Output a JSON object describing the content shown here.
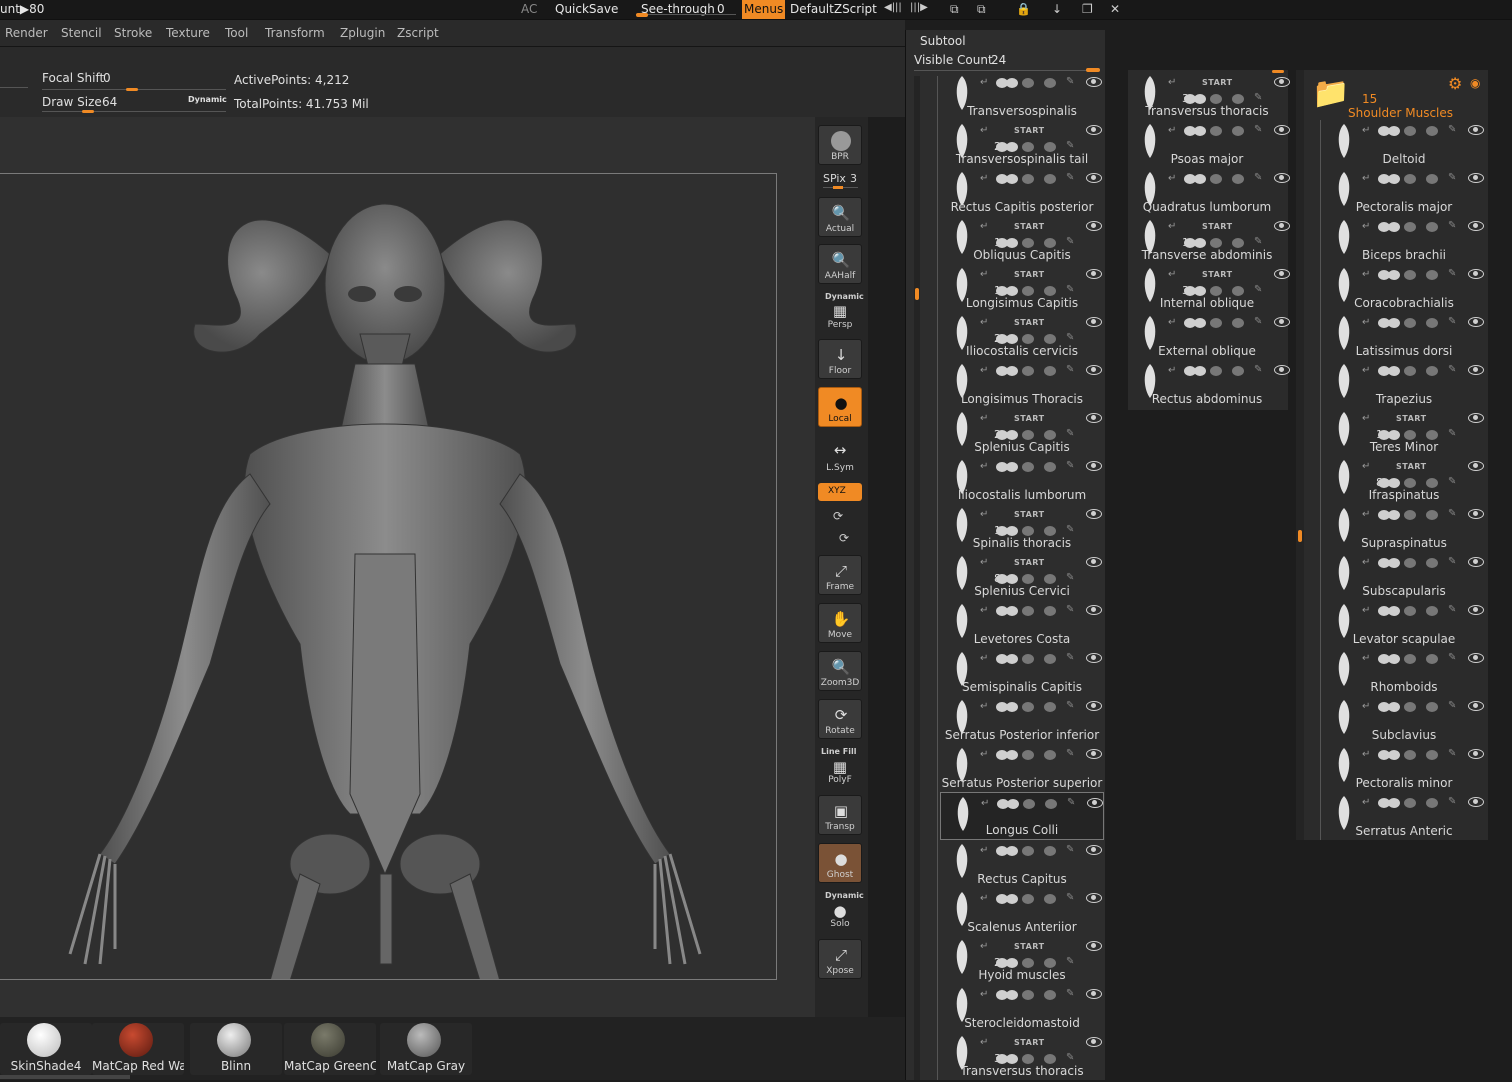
{
  "topbar": {
    "left_text": "unt▶80",
    "ac": "AC",
    "quicksave": "QuickSave",
    "seethrough_label": "See-through",
    "seethrough_value": "0",
    "menus": "Menus",
    "script": "DefaultZScript",
    "accent": "#f08a24"
  },
  "menubar": [
    "Render",
    "Stencil",
    "Stroke",
    "Texture",
    "Tool",
    "Transform",
    "Zplugin",
    "Zscript"
  ],
  "shelf": {
    "focal_label": "Focal Shift",
    "focal_value": "0",
    "draw_label": "Draw Size",
    "draw_value": "64",
    "dynamic": "Dynamic",
    "active_points": "ActivePoints: 4,212",
    "total_points": "TotalPoints: 41.753 Mil"
  },
  "right_tools": {
    "bpr": "BPR",
    "spix_label": "SPix",
    "spix_value": "3",
    "actual": "Actual",
    "aahalf": "AAHalf",
    "dynamic": "Dynamic",
    "persp": "Persp",
    "floor": "Floor",
    "local": "Local",
    "lsym": "L.Sym",
    "xyz": "XYZ",
    "frame": "Frame",
    "move": "Move",
    "zoom3d": "Zoom3D",
    "rotate": "Rotate",
    "linefill": "Line Fill",
    "polyf": "PolyF",
    "transp": "Transp",
    "ghost": "Ghost",
    "dynamic2": "Dynamic",
    "solo": "Solo",
    "xpose": "Xpose"
  },
  "materials": [
    {
      "name": "SkinShade4",
      "color": "#e8e8e8"
    },
    {
      "name": "MatCap Red Wax",
      "color": "#8a2a1a"
    },
    {
      "name": "Blinn",
      "color": "#b8b8b8"
    },
    {
      "name": "MatCap GreenClay",
      "color": "#5a5a4a"
    },
    {
      "name": "MatCap Gray",
      "color": "#8a8a8a"
    }
  ],
  "subtool": {
    "title": "Subtool",
    "visible_label": "Visible Count",
    "visible_value": "24",
    "start": "START",
    "col1": [
      {
        "name": "Transversospinalis",
        "count": ""
      },
      {
        "name": "Transversospinalis tail",
        "count": "2"
      },
      {
        "name": "Rectus Capitis posterior",
        "count": ""
      },
      {
        "name": "Obliquus Capitis",
        "count": "1"
      },
      {
        "name": "Longisimus Capitis",
        "count": "1"
      },
      {
        "name": "Iliocostalis cervicis",
        "count": "2"
      },
      {
        "name": "Longisimus Thoracis",
        "count": ""
      },
      {
        "name": "Splenius Capitis",
        "count": "2"
      },
      {
        "name": "Iliocostalis lumborum",
        "count": ""
      },
      {
        "name": "Spinalis thoracis",
        "count": "1"
      },
      {
        "name": "Splenius Cervici",
        "count": "8"
      },
      {
        "name": "Levetores Costa",
        "count": ""
      },
      {
        "name": "Semispinalis Capitis",
        "count": ""
      },
      {
        "name": "Serratus Posterior inferior",
        "count": ""
      },
      {
        "name": "Serratus Posterior superior",
        "count": ""
      },
      {
        "name": "Longus Colli",
        "count": ""
      },
      {
        "name": "Rectus Capitus",
        "count": ""
      },
      {
        "name": "Scalenus Anteriior",
        "count": ""
      },
      {
        "name": "Hyoid muscles",
        "count": "2"
      },
      {
        "name": "Sterocleidomastoid",
        "count": ""
      },
      {
        "name": "Transversus thoracis",
        "count": "3"
      }
    ],
    "col2": [
      {
        "name": "Transversus thoracis",
        "count": "3"
      },
      {
        "name": "Psoas major",
        "count": ""
      },
      {
        "name": "Quadratus lumborum",
        "count": ""
      },
      {
        "name": "Transverse abdominis",
        "count": "1"
      },
      {
        "name": "Internal oblique",
        "count": "3"
      },
      {
        "name": "External oblique",
        "count": ""
      },
      {
        "name": "Rectus abdominus",
        "count": ""
      }
    ],
    "col3_folder": {
      "count": "15",
      "name": "Shoulder Muscles"
    },
    "col3": [
      {
        "name": "Deltoid",
        "count": ""
      },
      {
        "name": "Pectoralis major",
        "count": ""
      },
      {
        "name": "Biceps brachii",
        "count": ""
      },
      {
        "name": "Coracobrachialis",
        "count": ""
      },
      {
        "name": "Latissimus dorsi",
        "count": ""
      },
      {
        "name": "Trapezius",
        "count": ""
      },
      {
        "name": "Teres Minor",
        "count": "1"
      },
      {
        "name": "Ifraspinatus",
        "count": "8"
      },
      {
        "name": "Supraspinatus",
        "count": ""
      },
      {
        "name": "Subscapularis",
        "count": ""
      },
      {
        "name": "Levator scapulae",
        "count": ""
      },
      {
        "name": "Rhomboids",
        "count": ""
      },
      {
        "name": "Subclavius",
        "count": ""
      },
      {
        "name": "Pectoralis minor",
        "count": ""
      },
      {
        "name": "Serratus Anteric",
        "count": ""
      }
    ]
  }
}
